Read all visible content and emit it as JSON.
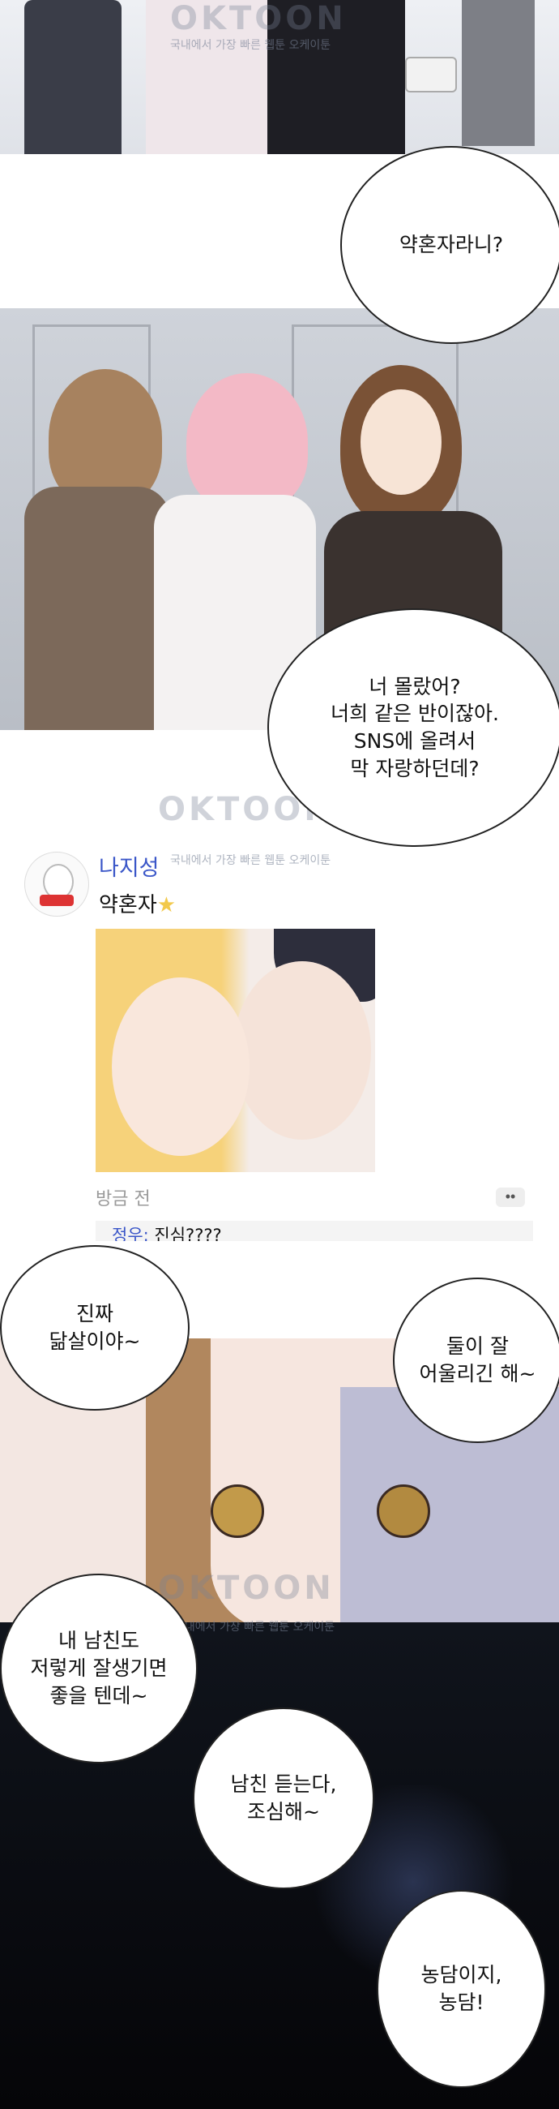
{
  "watermark": {
    "brand": "OKTOON",
    "sub": "국내에서 가장 빠른 웹툰 오케이툰"
  },
  "bubbles": {
    "b1": "약혼자라니?",
    "b2": "너 몰랐어?\n너희 같은 반이잖아.\nSNS에 올려서\n막 자랑하던데?",
    "b3": "진짜\n닮살이야~",
    "b4": "둘이 잘\n어울리긴 해~",
    "b5": "내 남친도\n저렇게 잘생기면\n좋을 텐데~",
    "b6": "남친 듣는다,\n조심해~",
    "b7": "농담이지,\n농담!"
  },
  "sns_post": {
    "username": "나지성",
    "caption": "약혼자",
    "star_icon": "star-icon",
    "timestamp": "방금 전",
    "more_icon": "more-dots-icon",
    "comment_author": "정우:",
    "comment_text": "진심????"
  },
  "colors": {
    "accent_blue": "#3a56c8",
    "star": "#f2c94c"
  }
}
